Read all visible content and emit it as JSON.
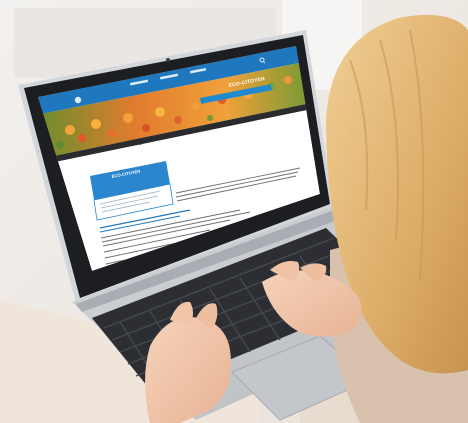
{
  "scene": {
    "description_free": true,
    "colors": {
      "background": "#f3f0ec",
      "laptop_body": "#c9ccd1",
      "bezel": "#1e1f22",
      "site_blue": "#1f7fc4",
      "flower_orange": "#e6762a",
      "flower_green": "#5f8f2f",
      "hair": "#e3b877",
      "skin": "#f1c6aa"
    }
  },
  "website": {
    "title": "ECO-CITOYEN",
    "banner": "",
    "nav": [
      "",
      "",
      ""
    ],
    "sidebar_title": "ÉCO-CITOYEN"
  },
  "icons": {
    "logo": "logo-icon",
    "search": "search-icon"
  }
}
